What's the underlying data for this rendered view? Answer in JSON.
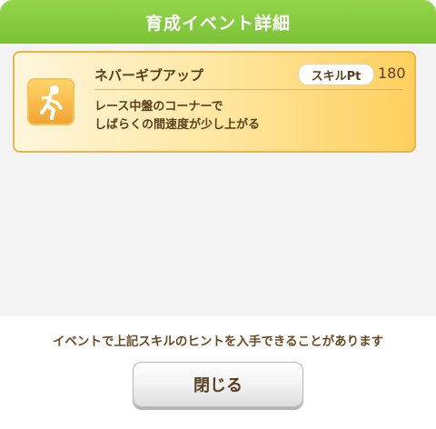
{
  "dialog": {
    "title": "育成イベント詳細",
    "skill": {
      "name": "ネバーギブアップ",
      "sp_label": "スキルPt",
      "sp_value": "180",
      "description": [
        "レース中盤のコーナーで",
        "しばらくの間速度が少し上がる"
      ],
      "icon": "running-figure-icon"
    },
    "footer_note": "イベントで上記スキルのヒントを入手できることがあります",
    "close_label": "閉じる"
  },
  "colors": {
    "title_bar": "#86ca3f",
    "card_border": "#e8b64a",
    "card_gradient_end": "#ffd05e",
    "text_brown": "#5a3e1f"
  }
}
